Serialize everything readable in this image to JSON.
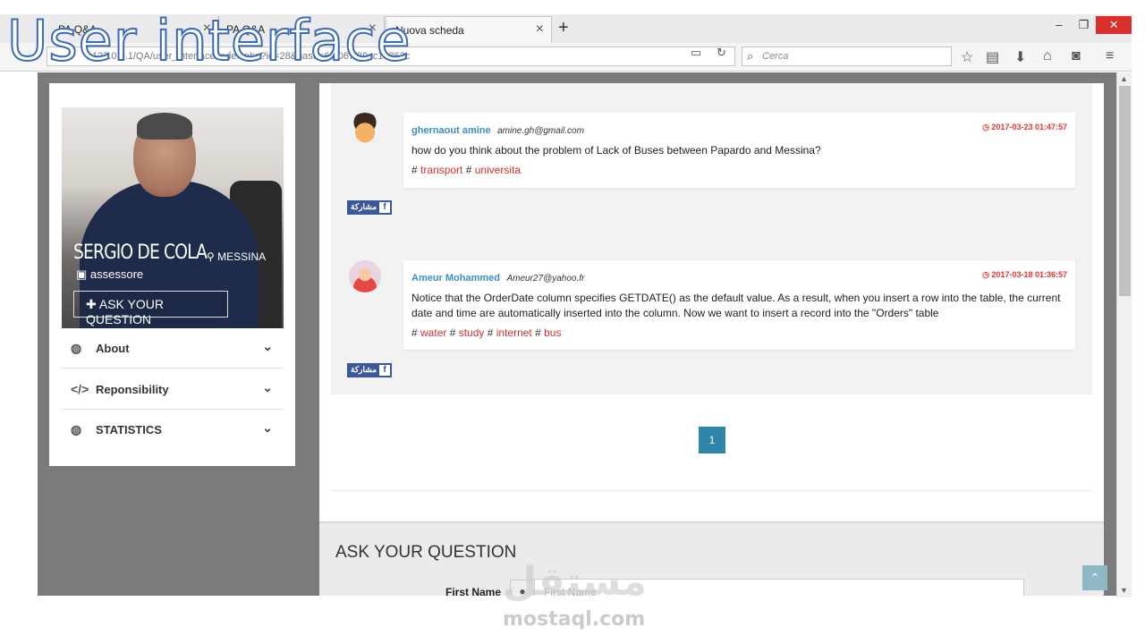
{
  "overlay_title": "User interface",
  "browser": {
    "tabs": [
      {
        "label": "PA Q&A"
      },
      {
        "label": "PA Q&A"
      },
      {
        "label": "Nuova scheda"
      }
    ],
    "new_tab": "+",
    "url": "127.0.0.1/QA/user_interface/index.php?id=28&hash=6f6067f89cc14862c",
    "search_placeholder": "Cerca",
    "window_controls": {
      "minimize": "–",
      "restore": "❐",
      "close": "✕"
    }
  },
  "sidebar": {
    "profile": {
      "name": "SERGIO DE COLA",
      "city": "MESSINA",
      "role": "assessore",
      "ask_button": "ASK YOUR QUESTION"
    },
    "menu": [
      {
        "label": "About",
        "icon": "globe-icon"
      },
      {
        "label": "Reponsibility",
        "icon": "code-icon"
      },
      {
        "label": "STATISTICS",
        "icon": "globe-icon"
      }
    ]
  },
  "questions": [
    {
      "user": "ghernaout amine",
      "email": "amine.gh@gmail.com",
      "date": "2017-03-23 01:47:57",
      "text": "how do you think about the problem of Lack of Buses between Papardo and Messina?",
      "tags": [
        "transport",
        "universita"
      ],
      "share": "مشاركة"
    },
    {
      "user": "Ameur Mohammed",
      "email": "Ameur27@yahoo.fr",
      "date": "2017-03-18 01:36:57",
      "text": "Notice that the OrderDate column specifies GETDATE() as the default value. As a result, when you insert a row into the table, the current date and time are automatically inserted into the column. Now we want to insert a record into the \"Orders\" table",
      "tags": [
        "water",
        "study",
        "internet",
        "bus"
      ],
      "share": "مشاركة"
    }
  ],
  "pagination": {
    "current": "1"
  },
  "ask_form": {
    "title": "ASK YOUR QUESTION",
    "first_name_label": "First Name",
    "first_name_placeholder": "First Name"
  },
  "watermark": {
    "arabic": "مستقل",
    "latin": "mostaql.com"
  },
  "colors": {
    "accent": "#2e86ab",
    "link": "#3a8fc5",
    "tag": "#d9302c",
    "facebook": "#3b5998"
  }
}
